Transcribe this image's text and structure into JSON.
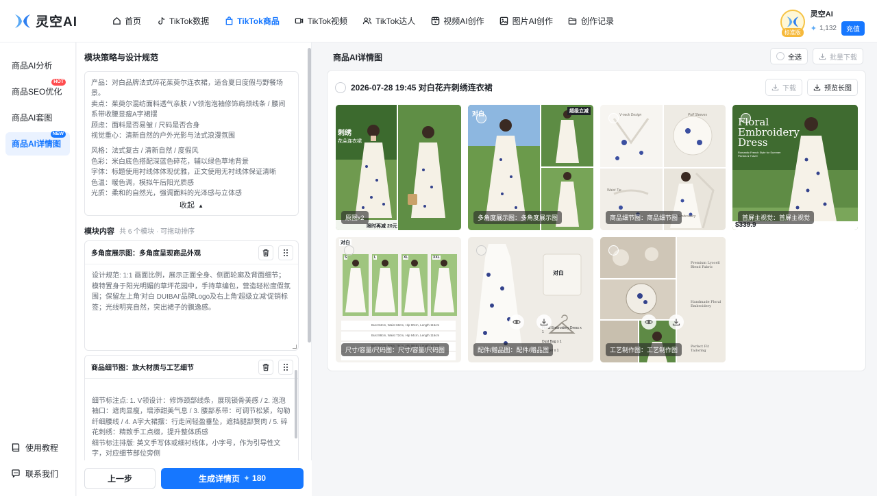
{
  "header": {
    "logo_text": "灵空AI",
    "nav": [
      {
        "label": "首页",
        "icon": "home-icon"
      },
      {
        "label": "TikTok数据",
        "icon": "tiktok-icon"
      },
      {
        "label": "TikTok商品",
        "icon": "shopping-bag-icon"
      },
      {
        "label": "TikTok视频",
        "icon": "video-icon"
      },
      {
        "label": "TikTok达人",
        "icon": "users-icon"
      },
      {
        "label": "视频AI创作",
        "icon": "film-icon"
      },
      {
        "label": "图片AI创作",
        "icon": "image-icon"
      },
      {
        "label": "创作记录",
        "icon": "folder-icon"
      }
    ],
    "active_nav": 2,
    "user": {
      "name": "灵空AI",
      "tier": "标准版",
      "credits": "1,132",
      "recharge_label": "充值"
    }
  },
  "sidebar": {
    "items": [
      {
        "label": "商品AI分析",
        "tag": ""
      },
      {
        "label": "商品SEO优化",
        "tag": "HOT"
      },
      {
        "label": "商品AI套图",
        "tag": ""
      },
      {
        "label": "商品AI详情图",
        "tag": "NEW"
      }
    ],
    "active": 3,
    "bottom": [
      {
        "label": "使用教程",
        "icon": "book-icon"
      },
      {
        "label": "联系我们",
        "icon": "chat-icon"
      }
    ]
  },
  "left_panel": {
    "strategy_title": "模块策略与设计规范",
    "strategy_lines_1": [
      "产品：对白品牌法式碎花茱萸尔连衣裙，适合夏日度假与野餐场景。",
      "卖点：茱萸尔混纺面料透气亲肤 / V领泡泡袖修饰肩颈线条 / 腰间系带收腰显瘦A字裙摆",
      "顾虑：面料是否易皱 / 尺码是否合身",
      "视觉重心：清新自然的户外光影与法式浪漫氛围"
    ],
    "strategy_lines_2": [
      "风格：法式复古 / 清新自然 / 度假风",
      "色彩：米白底色搭配深蓝色碎花，辅以绿色草地背景",
      "字体：标题使用衬线体体现优雅，正文使用无衬线体保证清晰",
      "色温：暖色调，模拟午后阳光质感",
      "光质：柔和的自然光，强调面料的光泽感与立体感"
    ],
    "collapse_label": "收起",
    "modules_title": "模块内容",
    "modules_meta": "共 6 个模块 · 可拖动排序",
    "modules": [
      {
        "name": "多角度展示图：多角度呈现商品外观",
        "body": "设计规范: 1:1 画面比例，展示正面全身、侧面轮廓及背面细节；模特置身于阳光明媚的草坪花园中，手持草编包，营造轻松度假氛围；保留左上角'对白 DUIBAI'品牌Logo及右上角'超级立减'促销标签；光线明亮自然，突出裙子的飘逸感。"
      },
      {
        "name": "商品细节图：放大材质与工艺细节",
        "body": "细节标注点: 1. V领设计：修饰颈部线条，展现锁骨美感 / 2. 泡泡袖口：遮肉显瘦，增添甜美气息 / 3. 腰部系带：可调节松紧，勾勒纤细腰线 / 4. A字大裙摆：行走间轻盈垂坠，遮挡腿部赘肉 / 5. 碎花刺绣：精致手工点缀，提升整体质感\n细节标注排版: 英文手写体或细衬线体，小字号，作为引导性文字，对应细节部位旁侧\n设计规范: 采用微距特写镜头拍摄面料纹理与刺绣针脚；背景虚化处理，聚焦于服装本身的质感；色彩还原真实，避免过度饱和；保留参考"
      }
    ],
    "prev_label": "上一步",
    "generate_label": "生成详情页",
    "generate_cost": "180"
  },
  "main": {
    "title": "商品AI详情图",
    "select_all_label": "全选",
    "batch_download_label": "批量下载",
    "result_title": "2026-07-28 19:45 对白花卉刺绣连衣裙",
    "download_label": "下载",
    "preview_label": "预览长图",
    "images": [
      {
        "label": "原图x2",
        "texts": [
          "刺绣",
          "花朵连衣裙",
          "限时再减 20元"
        ]
      },
      {
        "label": "多角度展示图：多角度展示图",
        "texts": [
          "对白",
          "超级立减"
        ]
      },
      {
        "label": "商品细节图：商品细节图",
        "texts": [
          "V-neck Design",
          "Puff Sleeves",
          "Waist Tie",
          "Floral Embroidery"
        ]
      },
      {
        "label": "首屏主视觉：首屏主视觉",
        "texts": [
          "Floral",
          "Embroidery",
          "Dress",
          "Romantic French Style for Summer Picnics & Travel",
          "$339.9"
        ]
      },
      {
        "label": "尺寸/容量/尺码图：尺寸/容量/尺码图",
        "texts": [
          "对白",
          "S",
          "L",
          "XL",
          "XXL",
          "Bust 84cm, Waist 68cm, Hip 90cm, Length 115cm",
          "Bust 88cm, Waist 72cm, Hip 94cm, Length 116cm",
          "Bust 92cm, Waist 76cm, Hip 98cm, Length 117cm"
        ]
      },
      {
        "label": "配件/赠品图：配件/赠品图",
        "texts": [
          "对白",
          "Floral Embroidery Dress x 1",
          "Dust Bag x 1",
          "Hanger x 1"
        ]
      },
      {
        "label": "工艺制作图：工艺制作图",
        "texts": [
          "Premium Lyocell Blend Fabric",
          "Handmade Floral Embroidery",
          "Perfect Fit Tailoring"
        ]
      }
    ]
  }
}
